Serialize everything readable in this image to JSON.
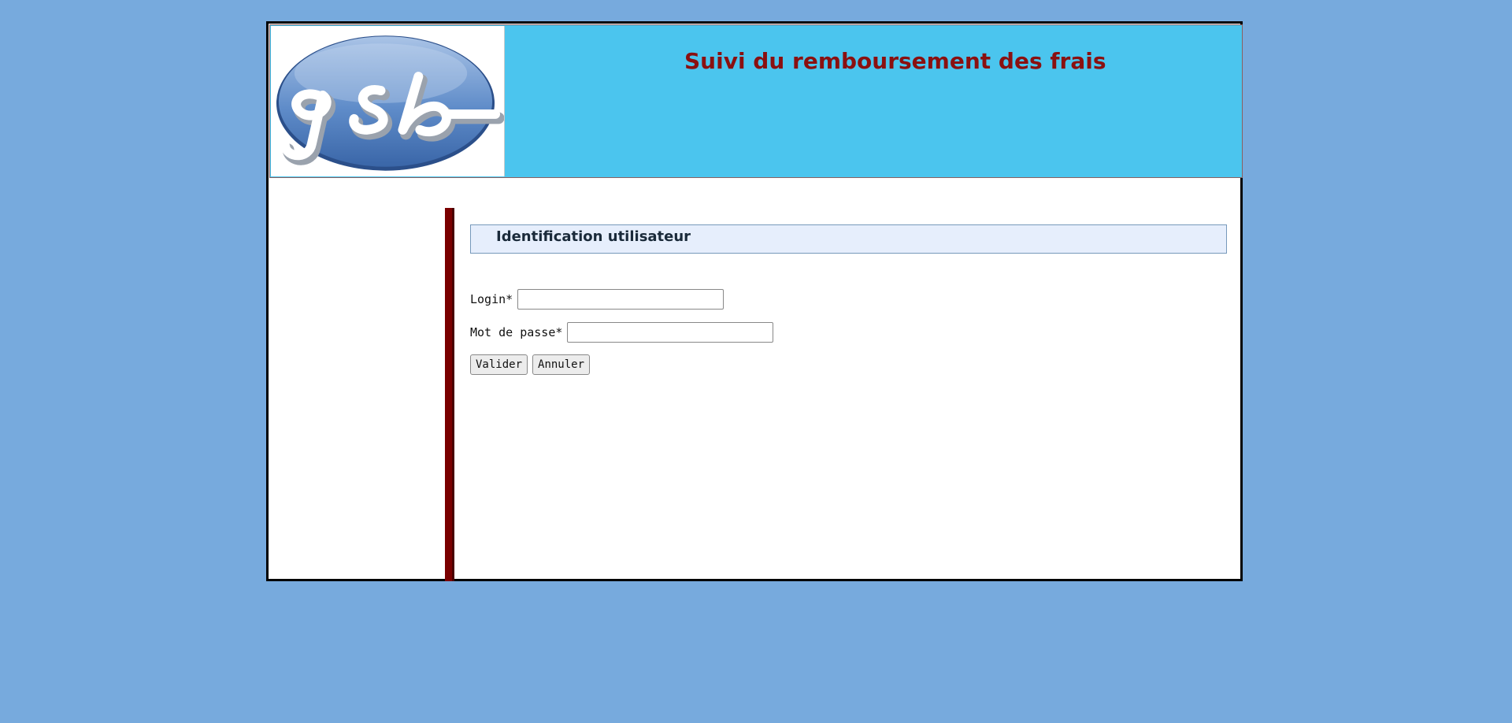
{
  "header": {
    "title": "Suivi du remboursement des frais",
    "logo": {
      "icon": "gsb-logo",
      "text": "gsb"
    }
  },
  "login_form": {
    "section_title": "Identification utilisateur",
    "login_label": "Login*",
    "login_value": "",
    "password_label": "Mot de passe*",
    "password_value": "",
    "submit_label": "Valider",
    "cancel_label": "Annuler"
  },
  "colors": {
    "background": "#77aadd",
    "header_bg": "#4bc5ee",
    "title": "#8a1010",
    "accent_bar": "#7a0000",
    "section_header_bg": "#e6eefc"
  }
}
